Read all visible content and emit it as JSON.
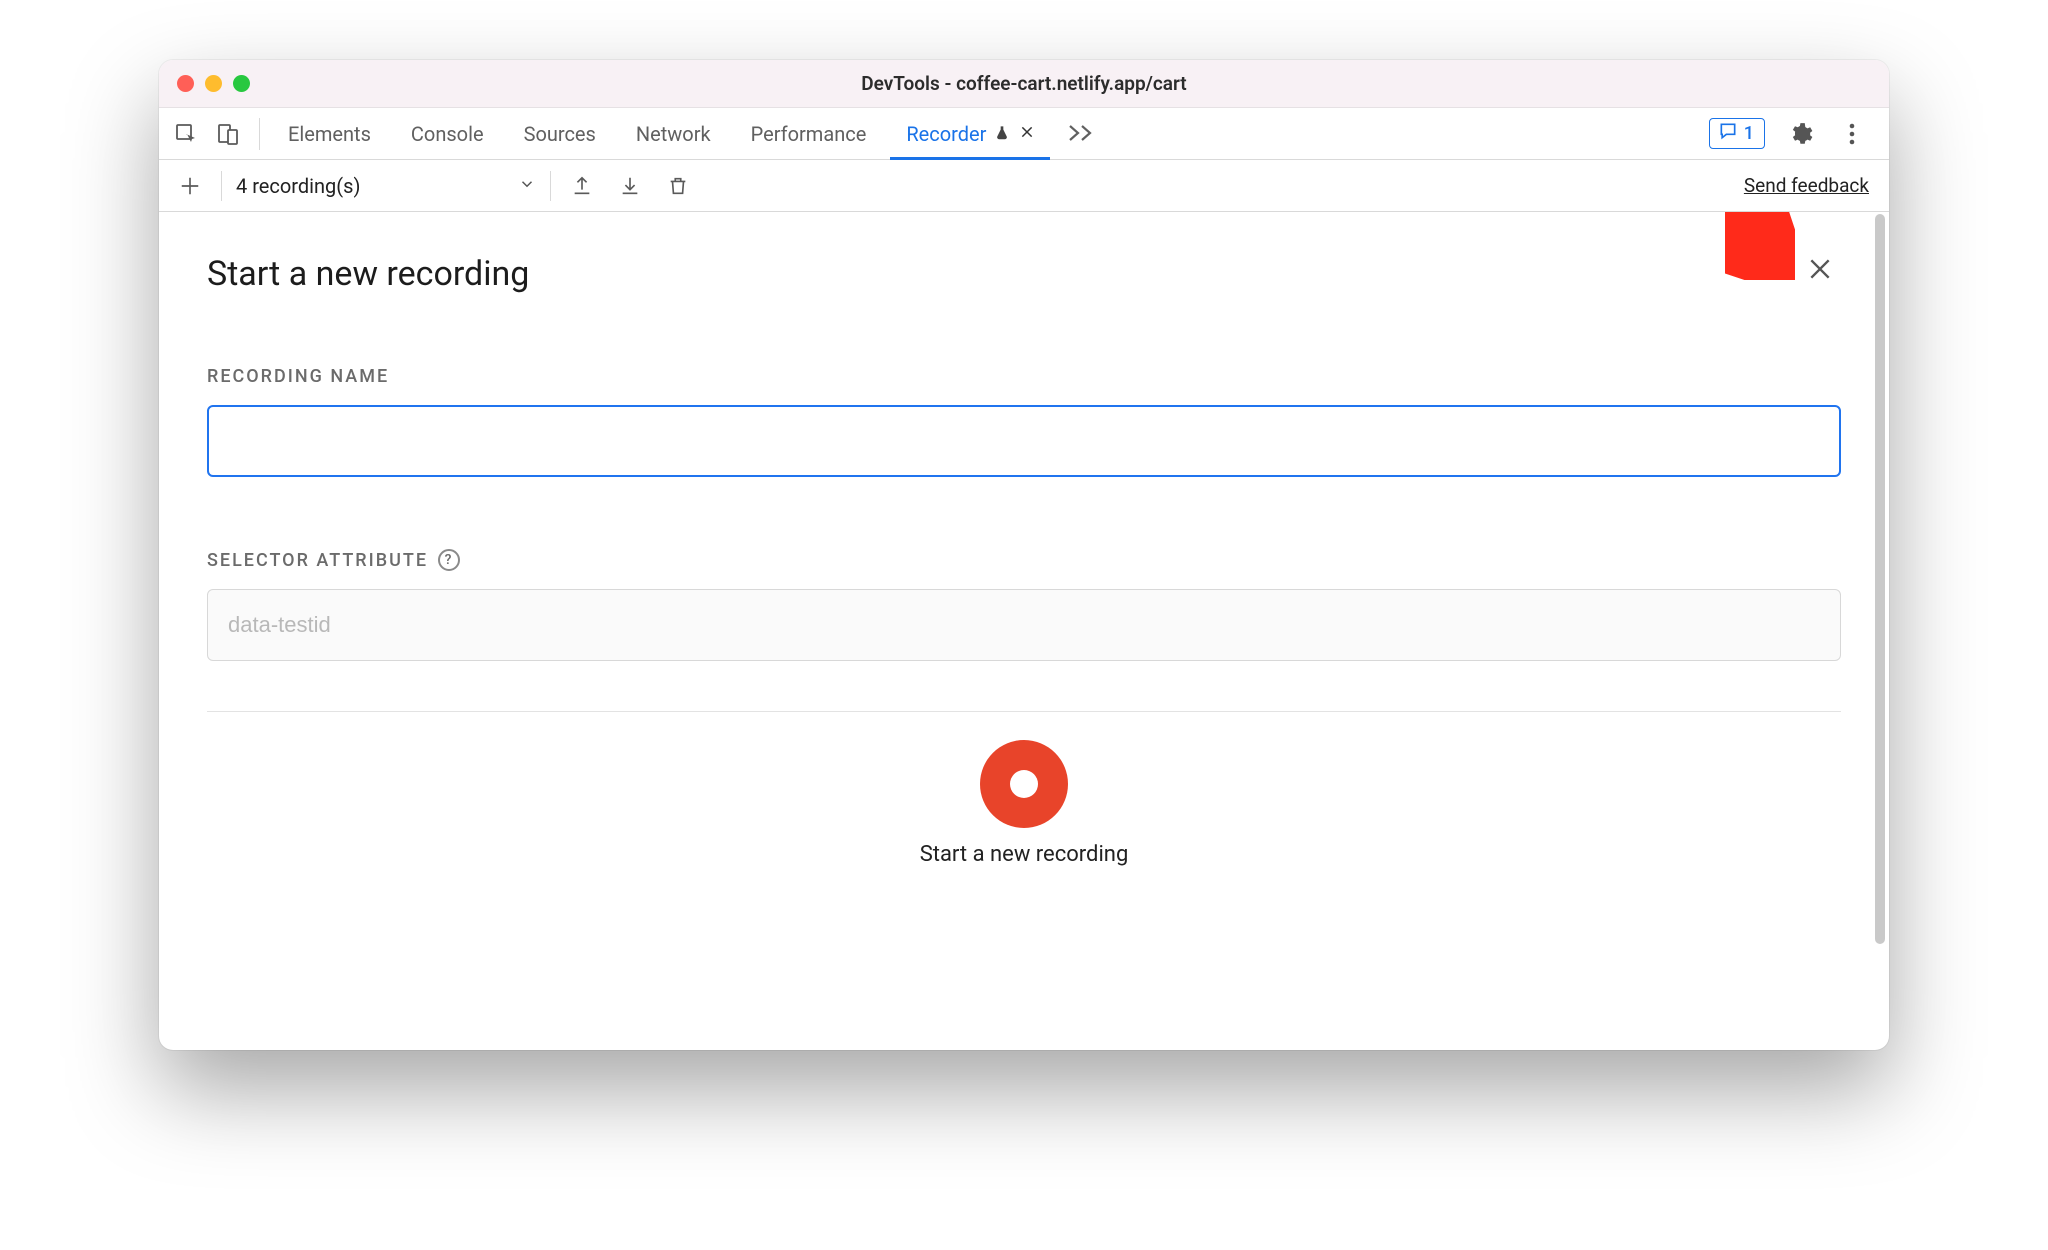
{
  "window": {
    "title": "DevTools - coffee-cart.netlify.app/cart"
  },
  "tabbar": {
    "tabs": [
      {
        "label": "Elements",
        "active": false
      },
      {
        "label": "Console",
        "active": false
      },
      {
        "label": "Sources",
        "active": false
      },
      {
        "label": "Network",
        "active": false
      },
      {
        "label": "Performance",
        "active": false
      },
      {
        "label": "Recorder",
        "active": true,
        "experimental": true,
        "closeable": true
      }
    ],
    "issues_count": "1"
  },
  "secondary": {
    "recordings_label": "4 recording(s)",
    "feedback_label": "Send feedback"
  },
  "panel": {
    "title": "Start a new recording",
    "recording_name": {
      "label": "RECORDING NAME",
      "value": ""
    },
    "selector_attribute": {
      "label": "SELECTOR ATTRIBUTE",
      "placeholder": "data-testid",
      "value": ""
    },
    "cta_label": "Start a new recording"
  },
  "icons": {
    "inspect": "inspect-icon",
    "device": "device-icon",
    "plus": "plus-icon",
    "chevron_down": "chevron-down-icon",
    "export": "export-icon",
    "import": "import-icon",
    "trash": "trash-icon",
    "gear": "gear-icon",
    "kebab": "kebab-icon",
    "close": "close-icon",
    "chat": "chat-icon",
    "help": "help-icon",
    "flask": "flask-icon",
    "overflow": "overflow-icon"
  }
}
